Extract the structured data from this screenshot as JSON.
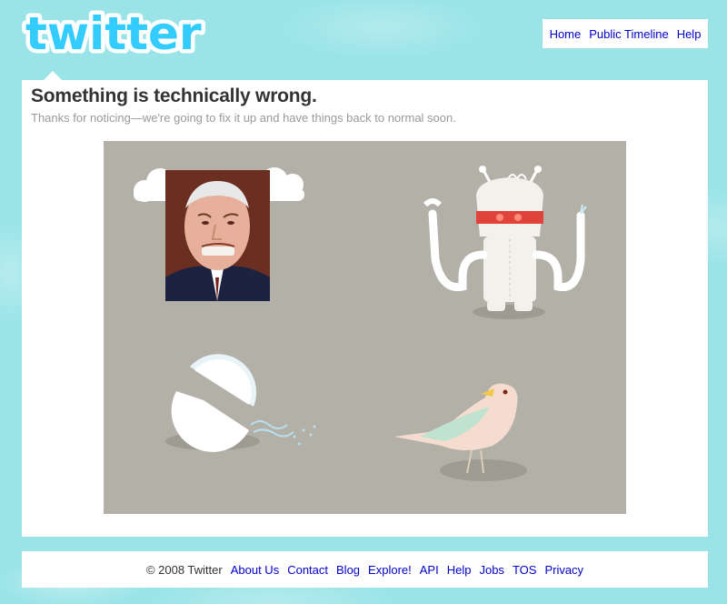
{
  "logo": {
    "text": "twitter"
  },
  "topnav": {
    "items": [
      "Home",
      "Public Timeline",
      "Help"
    ]
  },
  "error": {
    "title": "Something is technically wrong.",
    "message": "Thanks for noticing—we're going to fix it up and have things back to normal soon."
  },
  "illustration": {
    "background": "#b3b0a8",
    "elements": [
      "cloud-icon",
      "photo-face",
      "robot-icon",
      "broken-egg-icon",
      "bird-icon"
    ]
  },
  "footer": {
    "copyright": "© 2008 Twitter",
    "links": [
      "About Us",
      "Contact",
      "Blog",
      "Explore!",
      "API",
      "Help",
      "Jobs",
      "TOS",
      "Privacy"
    ]
  },
  "colors": {
    "background": "#9ae4e8",
    "link": "#0000cc",
    "logo": "#33ccff"
  }
}
